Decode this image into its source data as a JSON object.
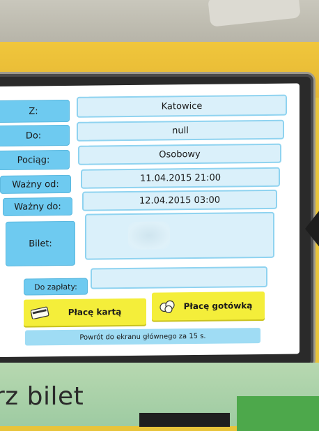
{
  "housing": {
    "bottom_text": "rz bilet"
  },
  "ticket": {
    "from_label": "Z:",
    "from_value": "Katowice",
    "to_label": "Do:",
    "to_value": "null",
    "train_label": "Pociąg:",
    "train_value": "Osobowy",
    "valid_from_label": "Ważny od:",
    "valid_from_value": "11.04.2015 21:00",
    "valid_to_label": "Ważny do:",
    "valid_to_value": "12.04.2015 03:00",
    "ticket_label": "Bilet:",
    "ticket_value": "",
    "to_pay_label": "Do zapłaty:",
    "to_pay_value": ""
  },
  "actions": {
    "pay_card_label": "Płacę kartą",
    "pay_cash_label": "Płacę gotówką",
    "card_icon": "credit-card-icon",
    "cash_icon": "coins-icon"
  },
  "footer": {
    "return_text": "Powrót do ekranu głównego za 15 s."
  },
  "colors": {
    "label_blue": "#6ecaf0",
    "value_blue": "#daf0fa",
    "button_yellow": "#f4ee3a",
    "housing_yellow": "#e5b733",
    "housing_green": "#9ecba2"
  }
}
